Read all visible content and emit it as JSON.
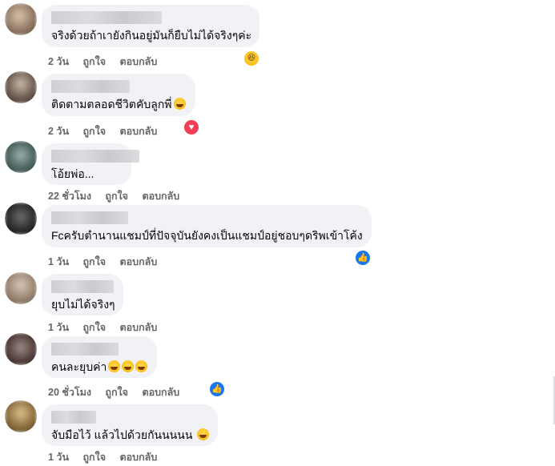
{
  "comments": [
    {
      "text": "จริงด้วยถ้าเายังกินอยู่มันก็ยืบไม่ได้จริงๆค่ะ",
      "time": "2 วัน",
      "like": "ถูกใจ",
      "reply": "ตอบกลับ",
      "reaction": "haha-icon",
      "emoji_suffix": []
    },
    {
      "text": "ติดตามตลอดชีวิตคับลูกพี่",
      "time": "2 วัน",
      "like": "ถูกใจ",
      "reply": "ตอบกลับ",
      "reaction": "love-icon",
      "emoji_suffix": [
        "smile-emoji"
      ]
    },
    {
      "text": "โอ้ยพ่อ...",
      "time": "22 ชั่วโมง",
      "like": "ถูกใจ",
      "reply": "ตอบกลับ",
      "reaction": "",
      "emoji_suffix": []
    },
    {
      "text": "Fcครับตำนานแชมป์ที่ปัจจุบันยังคงเป็นแชมป์อยู่ชอบๆดริพเข้าโค้ง",
      "time": "1 วัน",
      "like": "ถูกใจ",
      "reply": "ตอบกลับ",
      "reaction": "like-icon",
      "emoji_suffix": []
    },
    {
      "text": "ยุบไม่ได้จริงๆ",
      "time": "1 วัน",
      "like": "ถูกใจ",
      "reply": "ตอบกลับ",
      "reaction": "",
      "emoji_suffix": []
    },
    {
      "text": "คนละยุบค่า",
      "time": "20 ชั่วโมง",
      "like": "ถูกใจ",
      "reply": "ตอบกลับ",
      "reaction": "like-icon",
      "emoji_suffix": [
        "laugh-emoji",
        "laugh-emoji",
        "laugh-emoji"
      ]
    },
    {
      "text": "จับมือไว้ แล้วไปด้วยกันนนนน",
      "time": "1 วัน",
      "like": "ถูกใจ",
      "reply": "ตอบกลับ",
      "reaction": "",
      "emoji_suffix": [
        "smile-emoji"
      ]
    }
  ],
  "colors": {
    "bubble": "#f0f2f5",
    "meta_text": "#65676b",
    "like_blue": "#1877f2",
    "love_red": "#f33e58"
  }
}
